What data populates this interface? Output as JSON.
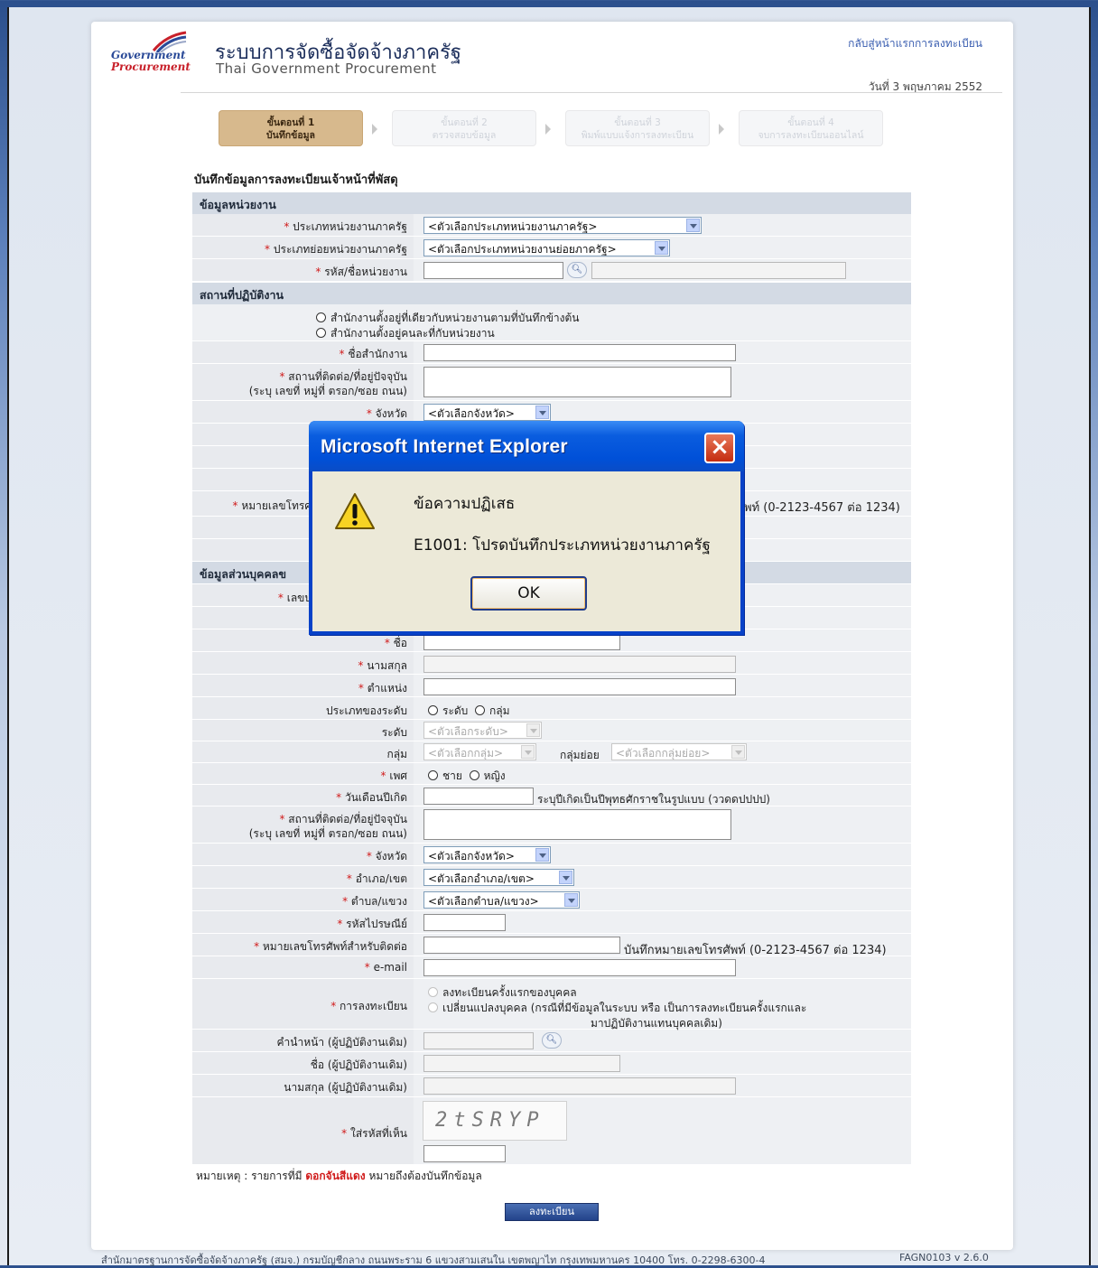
{
  "header": {
    "logo_line1": "Government",
    "logo_line2": "Procurement",
    "title_th": "ระบบการจัดซื้อจัดจ้างภาครัฐ",
    "title_en": "Thai Government Procurement",
    "home_link": "กลับสู่หน้าแรกการลงทะเบียน",
    "date": "วันที่ 3 พฤษภาคม 2552"
  },
  "steps": [
    {
      "l1": "ขั้นตอนที่ 1",
      "l2": "บันทึกข้อมูล",
      "active": true
    },
    {
      "l1": "ขั้นตอนที่ 2",
      "l2": "ตรวจสอบข้อมูล",
      "active": false
    },
    {
      "l1": "ขั้นตอนที่ 3",
      "l2": "พิมพ์แบบแจ้งการลงทะเบียน",
      "active": false
    },
    {
      "l1": "ขั้นตอนที่ 4",
      "l2": "จบการลงทะเบียนออนไลน์",
      "active": false
    }
  ],
  "form": {
    "title": "บันทึกข้อมูลการลงทะเบียนเจ้าหน้าที่พัสดุ",
    "sec_agency": "ข้อมูลหน่วยงาน",
    "agency_type_label": "ประเภทหน่วยงานภาครัฐ",
    "agency_type_value": "<ตัวเลือกประเภทหน่วยงานภาครัฐ>",
    "agency_subtype_label": "ประเภทย่อยหน่วยงานภาครัฐ",
    "agency_subtype_value": "<ตัวเลือกประเภทหน่วยงานย่อยภาครัฐ>",
    "agency_code_label": "รหัส/ชื่อหน่วยงาน",
    "sec_location": "สถานที่ปฏิบัติงาน",
    "loc_opt1": "สำนักงานตั้งอยู่ที่เดียวกับหน่วยงานตามที่บันทึกข้างต้น",
    "loc_opt2": "สำนักงานตั้งอยู่คนละที่กับหน่วยงาน",
    "office_name_label": "ชื่อสำนักงาน",
    "address_label": "สถานที่ติดต่อ/ที่อยู่ปัจจุบัน",
    "address_sub": "(ระบุ เลขที่ หมู่ที่ ตรอก/ซอย ถนน)",
    "province_label": "จังหวัด",
    "province_value": "<ตัวเลือกจังหวัด>",
    "phone_label_partial": "หมายเลขโทรศ",
    "phone_hint_partial": "พท์ (0-2123-4567 ต่อ 1234)",
    "sec_personal_partial": "ข้อมูลส่วนบุคคลข",
    "id_label_partial": "เลขบ",
    "firstname_label": "ชื่อ",
    "lastname_label": "นามสกุล",
    "position_label": "ตำแหน่ง",
    "level_type_label": "ประเภทของระดับ",
    "level_type_opt1": "ระดับ",
    "level_type_opt2": "กลุ่ม",
    "level_label": "ระดับ",
    "level_value": "<ตัวเลือกระดับ>",
    "group_label": "กลุ่ม",
    "group_value": "<ตัวเลือกกลุ่ม>",
    "subgroup_label": "กลุ่มย่อย",
    "subgroup_value": "<ตัวเลือกกลุ่มย่อย>",
    "gender_label": "เพศ",
    "gender_male": "ชาย",
    "gender_female": "หญิง",
    "dob_label": "วันเดือนปีเกิด",
    "dob_hint": "ระบุปีเกิดเป็นปีพุทธศักราชในรูปแบบ (ววดดปปปป)",
    "address2_label": "สถานที่ติดต่อ/ที่อยู่ปัจจุบัน",
    "address2_sub": "(ระบุ เลขที่ หมู่ที่ ตรอก/ซอย ถนน)",
    "province2_label": "จังหวัด",
    "province2_value": "<ตัวเลือกจังหวัด>",
    "district_label": "อำเภอ/เขต",
    "district_value": "<ตัวเลือกอำเภอ/เขต>",
    "subdistrict_label": "ตำบล/แขวง",
    "subdistrict_value": "<ตัวเลือกตำบล/แขวง>",
    "postcode_label": "รหัสไปรษณีย์",
    "phone2_label": "หมายเลขโทรศัพท์สำหรับติดต่อ",
    "phone2_hint": "บันทึกหมายเลขโทรศัพท์ (0-2123-4567 ต่อ 1234)",
    "email_label": "e-mail",
    "reg_label": "การลงทะเบียน",
    "reg_opt1": "ลงทะเบียนครั้งแรกของบุคคล",
    "reg_opt2_l1": "เปลี่ยนแปลงบุคคล (กรณีที่มีข้อมูลในระบบ หรือ เป็นการลงทะเบียนครั้งแรกและ",
    "reg_opt2_l2": "มาปฏิบัติงานแทนบุคคลเดิม)",
    "prev_title_label": "คำนำหน้า (ผู้ปฏิบัติงานเดิม)",
    "prev_name_label": "ชื่อ (ผู้ปฏิบัติงานเดิม)",
    "prev_lastname_label": "นามสกุล (ผู้ปฏิบัติงานเดิม)",
    "captcha_label": "ใส่รหัสที่เห็น",
    "captcha_text": "2tSRYP",
    "note_prefix": "หมายเหตุ : รายการที่มี",
    "note_red": "ดอกจันสีแดง",
    "note_suffix": "หมายถึงต้องบันทึกข้อมูล",
    "submit_label": "ลงทะเบียน"
  },
  "footer": {
    "text": "สำนักมาตรฐานการจัดซื้อจัดจ้างภาครัฐ (สมจ.) กรมบัญชีกลาง ถนนพระราม 6 แขวงสามเสนใน เขตพญาไท กรุงเทพมหานคร 10400 โทร. 0-2298-6300-4",
    "version": "FAGN0103 v 2.6.0"
  },
  "dialog": {
    "title": "Microsoft Internet Explorer",
    "heading": "ข้อความปฏิเสธ",
    "message": "E1001: โปรดบันทึกประเภทหน่วยงานภาครัฐ",
    "ok_label": "OK"
  },
  "colors": {
    "active_step": "#d7b98d",
    "section_bar": "#d3dae4",
    "required_star": "#d01a1a",
    "dialog_blue": "#0842c8"
  }
}
